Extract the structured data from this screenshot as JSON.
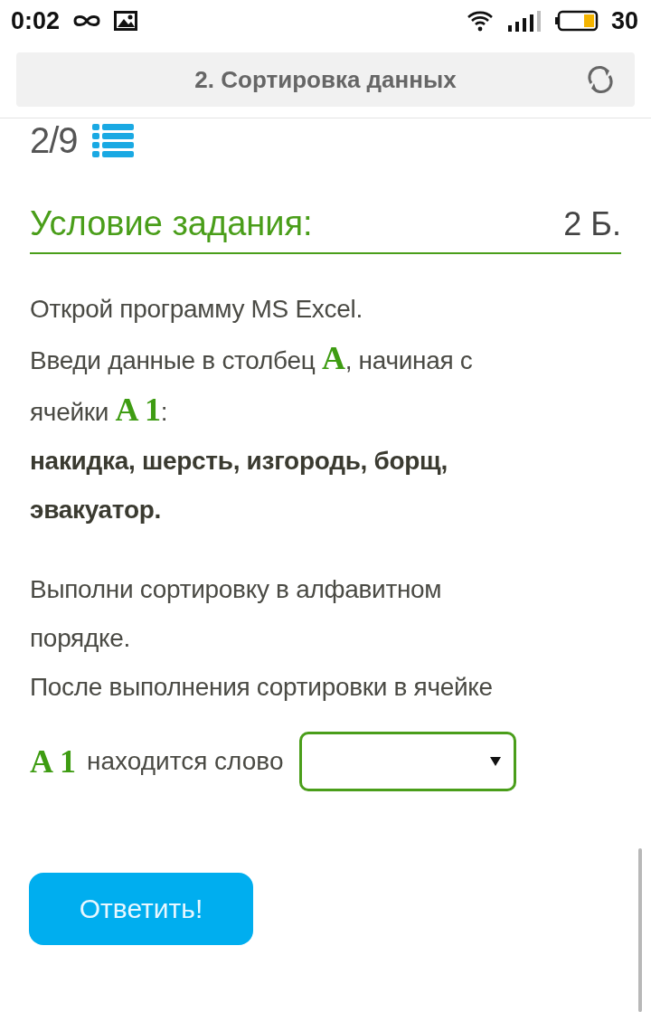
{
  "status_bar": {
    "time": "0:02",
    "battery": "30"
  },
  "header": {
    "title": "2. Сортировка данных"
  },
  "progress": {
    "text": "2/9"
  },
  "task": {
    "heading": "Условие задания:",
    "points": "2 Б.",
    "paragraphs": [
      [
        {
          "kind": "text",
          "text": "Открой программу MS Excel.\nВведи данные в столбец "
        },
        {
          "kind": "ref",
          "text": "A"
        },
        {
          "kind": "text",
          "text": ", начиная с\nячейки "
        },
        {
          "kind": "ref",
          "text": "A 1"
        },
        {
          "kind": "text",
          "text": ":\n"
        },
        {
          "kind": "strong",
          "text": "накидка, шерсть, изгородь, борщ,\nэвакуатор."
        }
      ],
      [
        {
          "kind": "text",
          "text": "Выполни сортировку в алфавитном\nпорядке.\nПосле выполнения сортировки в ячейке"
        }
      ]
    ],
    "answer": {
      "ref": "A 1",
      "prompt": "находится слово"
    }
  },
  "submit": {
    "label": "Ответить!"
  }
}
